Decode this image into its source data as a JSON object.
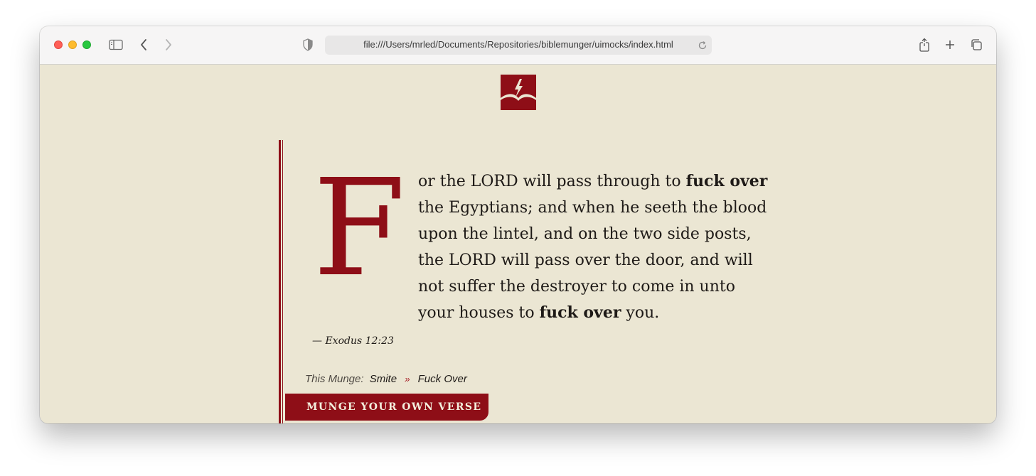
{
  "browser": {
    "url": "file:///Users/mrled/Documents/Repositories/biblemunger/uimocks/index.html"
  },
  "colors": {
    "accent": "#8e0e17",
    "page_background": "#ebe6d3",
    "text": "#1e1a17"
  },
  "verse": {
    "dropcap": "F",
    "lines": [
      {
        "pre": "or the LORD will pass through to ",
        "bold": "fuck over",
        "post": ""
      },
      {
        "pre": "the Egyptians; and when he seeth the blood",
        "bold": "",
        "post": ""
      },
      {
        "pre": "upon the lintel, and on the two side posts,",
        "bold": "",
        "post": ""
      },
      {
        "pre": "the LORD will pass over the door, and will",
        "bold": "",
        "post": ""
      },
      {
        "pre": "not suffer the destroyer to come in unto",
        "bold": "",
        "post": ""
      },
      {
        "pre": "your houses to ",
        "bold": "fuck over",
        "post": " you."
      }
    ],
    "citation": "— Exodus 12:23"
  },
  "munge": {
    "prefix": "This Munge:",
    "from": "Smite",
    "separator": "»",
    "to": "Fuck Over"
  },
  "cta_label": "MUNGE YOUR OWN VERSE",
  "icons": [
    "sidebar-icon",
    "back-icon",
    "forward-icon",
    "shield-icon",
    "reload-icon",
    "share-icon",
    "new-tab-icon",
    "tabs-overview-icon",
    "biblemunger-logo"
  ]
}
